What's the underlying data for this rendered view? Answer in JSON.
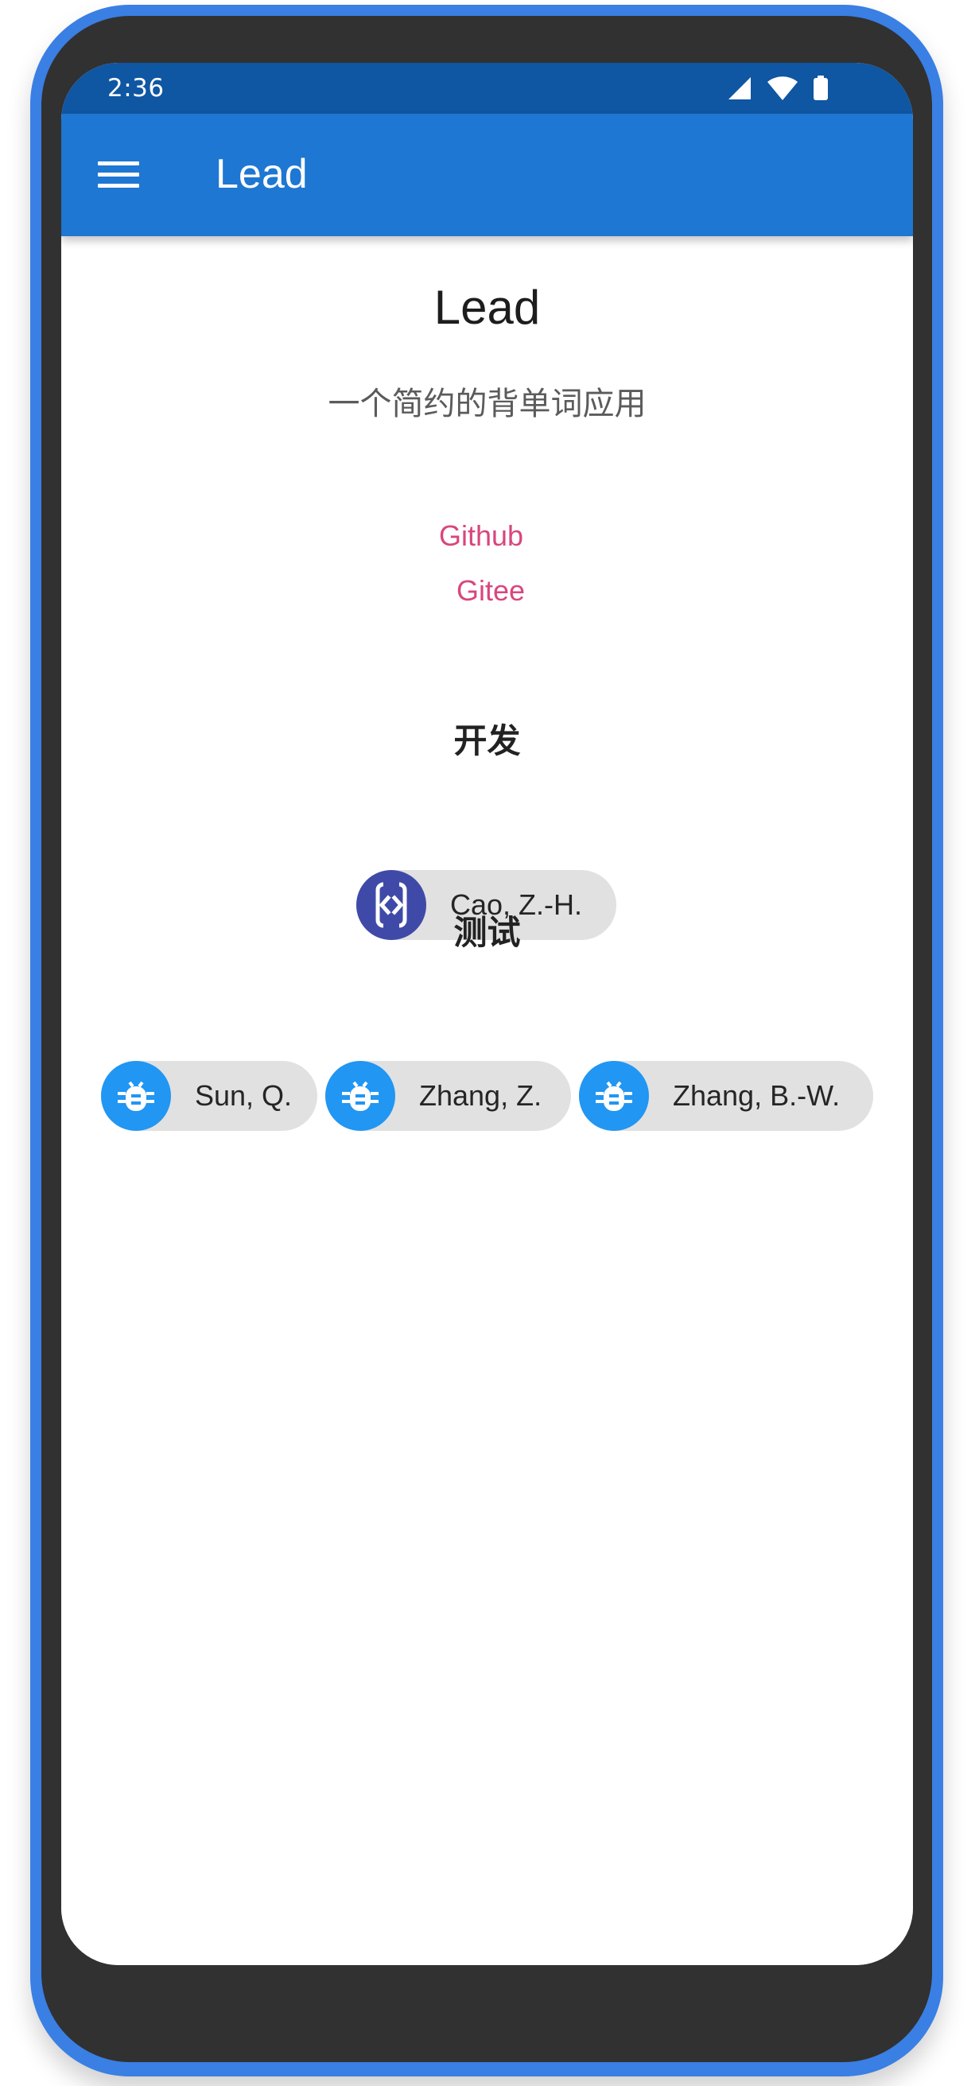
{
  "status_bar": {
    "time": "2:36",
    "icons": [
      "signal-icon",
      "wifi-icon",
      "battery-icon"
    ]
  },
  "app_bar": {
    "menu_icon": "menu-icon",
    "title": "Lead",
    "background": "#1E77D2"
  },
  "about": {
    "title": "Lead",
    "subtitle": "一个简约的背单词应用",
    "links": {
      "github": "Github",
      "gitee": "Gitee"
    },
    "sections": {
      "developers": {
        "title": "开发",
        "people": [
          {
            "name": "Cao, Z.-H.",
            "icon": "developer-mode-icon"
          }
        ]
      },
      "testers": {
        "title": "测试",
        "people": [
          {
            "name": "Sun, Q.",
            "icon": "bug-icon"
          },
          {
            "name": "Zhang, Z.",
            "icon": "bug-icon"
          },
          {
            "name": "Zhang, B.-W.",
            "icon": "bug-icon"
          }
        ]
      }
    }
  },
  "colors": {
    "status_bar": "#0F56A3",
    "link": "#D9467D",
    "developer_avatar": "#3F4AA8",
    "tester_avatar": "#2196F3",
    "chip_background": "#E1E1E1",
    "device_frame": "#3A7FE3"
  }
}
